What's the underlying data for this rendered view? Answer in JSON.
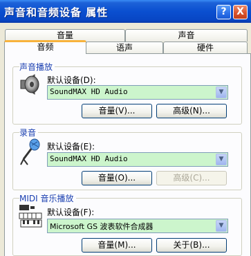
{
  "window": {
    "title": "声音和音频设备 属性",
    "help_label": "?",
    "close_label": "X"
  },
  "tabs": {
    "row1": [
      "音量",
      "声音"
    ],
    "row2": [
      "音频",
      "语声",
      "硬件"
    ],
    "active": "音频"
  },
  "playback": {
    "group_label": "声音播放",
    "default_device_label": "默认设备(D):",
    "device_value": "SoundMAX HD Audio",
    "volume_button": "音量(V)...",
    "advanced_button": "高级(N)...",
    "icon": "speaker-icon"
  },
  "recording": {
    "group_label": "录音",
    "default_device_label": "默认设备(E):",
    "device_value": "SoundMAX HD Audio",
    "volume_button": "音量(O)...",
    "advanced_button": "高级(C)...",
    "icon": "microphone-icon"
  },
  "midi": {
    "group_label": "MIDI 音乐播放",
    "default_device_label": "默认设备(F):",
    "device_value": "Microsoft GS 波表软件合成器",
    "volume_button": "音量(M)...",
    "about_button": "关于(B)...",
    "icon": "midi-keyboard-icon"
  },
  "colors": {
    "titlebar": "#0a4fd0",
    "combo_bg": "#ccf5cc",
    "tab_accent": "#f8b33c"
  }
}
